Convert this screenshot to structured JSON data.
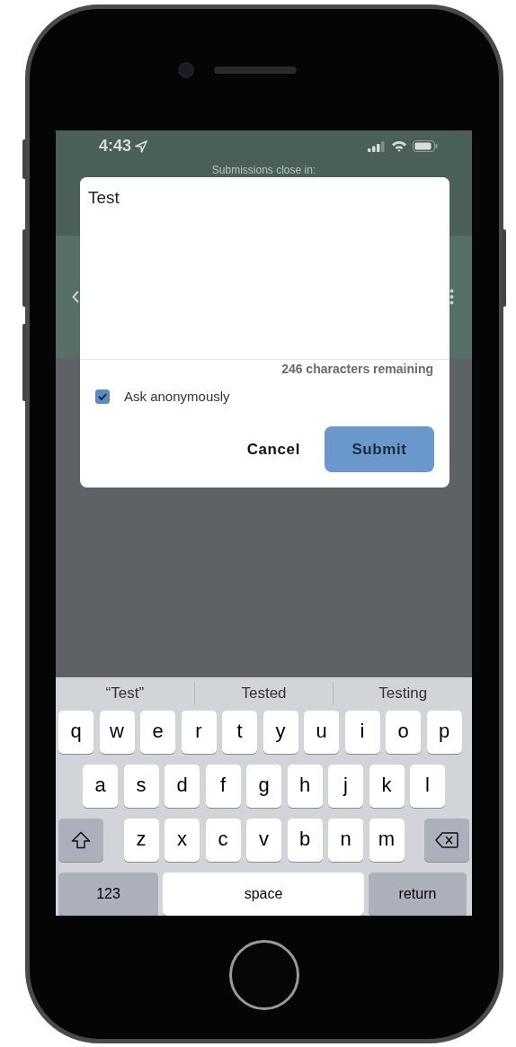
{
  "status_bar": {
    "time": "4:43"
  },
  "app_header": {
    "subtitle": "Submissions close in:"
  },
  "dialog": {
    "question": {
      "value": "Test"
    },
    "counter": "246 characters remaining",
    "anonymous": {
      "label": "Ask anonymously",
      "checked": true
    },
    "buttons": [
      {
        "label": "Cancel",
        "kind": "text"
      },
      {
        "label": "Submit",
        "kind": "primary"
      }
    ]
  },
  "keyboard": {
    "suggestions": [
      {
        "label": "“Test”"
      },
      {
        "label": "Tested"
      },
      {
        "label": "Testing"
      }
    ],
    "rows": [
      {
        "keys": [
          {
            "label": "q",
            "kind": "letter"
          },
          {
            "label": "w",
            "kind": "letter"
          },
          {
            "label": "e",
            "kind": "letter"
          },
          {
            "label": "r",
            "kind": "letter"
          },
          {
            "label": "t",
            "kind": "letter"
          },
          {
            "label": "y",
            "kind": "letter"
          },
          {
            "label": "u",
            "kind": "letter"
          },
          {
            "label": "i",
            "kind": "letter"
          },
          {
            "label": "o",
            "kind": "letter"
          },
          {
            "label": "p",
            "kind": "letter"
          }
        ]
      },
      {
        "keys": [
          {
            "label": "a",
            "kind": "letter"
          },
          {
            "label": "s",
            "kind": "letter"
          },
          {
            "label": "d",
            "kind": "letter"
          },
          {
            "label": "f",
            "kind": "letter"
          },
          {
            "label": "g",
            "kind": "letter"
          },
          {
            "label": "h",
            "kind": "letter"
          },
          {
            "label": "j",
            "kind": "letter"
          },
          {
            "label": "k",
            "kind": "letter"
          },
          {
            "label": "l",
            "kind": "letter"
          }
        ]
      },
      {
        "keys": [
          {
            "kind": "shift"
          },
          {
            "label": "z",
            "kind": "letter"
          },
          {
            "label": "x",
            "kind": "letter"
          },
          {
            "label": "c",
            "kind": "letter"
          },
          {
            "label": "v",
            "kind": "letter"
          },
          {
            "label": "b",
            "kind": "letter"
          },
          {
            "label": "n",
            "kind": "letter"
          },
          {
            "label": "m",
            "kind": "letter"
          },
          {
            "kind": "delete"
          }
        ]
      },
      {
        "keys": [
          {
            "label": "123",
            "kind": "function"
          },
          {
            "label": "space",
            "kind": "space"
          },
          {
            "label": "return",
            "kind": "function"
          }
        ]
      }
    ]
  }
}
